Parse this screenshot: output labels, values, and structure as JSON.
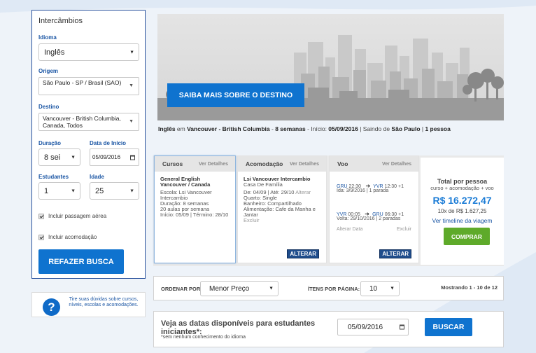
{
  "sidebar": {
    "title": "Intercâmbios",
    "idioma_label": "Idioma",
    "idioma_value": "Inglês",
    "origem_label": "Origem",
    "origem_value": "São Paulo - SP / Brasil (SAO)",
    "destino_label": "Destino",
    "destino_value": "Vancouver - British Columbia, Canada, Todos",
    "duracao_label": "Duração",
    "duracao_value": "8 sei",
    "data_label": "Data de Início",
    "data_value": "05/09/2016",
    "estudantes_label": "Estudantes",
    "estudantes_value": "1",
    "idade_label": "Idade",
    "idade_value": "25",
    "chk_passagem": "Incluir passagem aérea",
    "chk_acomodacao": "Incluir acomodação",
    "refazer_label": "REFAZER BUSCA"
  },
  "help": {
    "icon_char": "?",
    "text": "Tire suas dúvidas sobre cursos, níveis, escolas e acomodações."
  },
  "banner": {
    "button_label": "SAIBA MAIS SOBRE O DESTINO"
  },
  "summary": {
    "lang": "Inglês",
    "em": " em ",
    "dest": "Vancouver - British Columbia",
    "sep1": " - ",
    "weeks": "8 semanas",
    "sep2": " - Início: ",
    "start": "05/09/2016",
    "sep3": " | Saindo de ",
    "origin": "São Paulo",
    "sep4": " | ",
    "people": "1 pessoa"
  },
  "cursos": {
    "title": "Cursos",
    "details": "Ver Detalhes",
    "name": "General English",
    "city": "Vancouver / Canada",
    "school": "Escola: Lsi Vancouver Intercambio",
    "duration": "Duração: 8 semanas",
    "lessons": "20 aulas por semana",
    "dates": "Início: 05/09 | Término: 28/10"
  },
  "acomodacao": {
    "title": "Acomodação",
    "details": "Ver Detalhes",
    "name": "Lsi Vancouver Intercambio",
    "type": "Casa De Família",
    "dates": "De: 04/09 | Até: 29/10",
    "alterar_inline": "Alterar",
    "room": "Quarto: Single",
    "bath": "Banheiro: Compartilhado",
    "food": "Alimentação: Cafe da Manha e Jantar",
    "excluir": "Excluir",
    "alterar_btn": "ALTERAR"
  },
  "voo": {
    "title": "Voo",
    "details": "Ver Detalhes",
    "out_from": "GRU",
    "out_from_time": "22:30",
    "out_to": "YVR",
    "out_to_time": "12:30 +1",
    "out_info": "Ida: 3/9/2016 | 1 parada",
    "ret_from": "YVR",
    "ret_from_time": "00:05",
    "ret_to": "GRU",
    "ret_to_time": "06:30 +1",
    "ret_info": "Volta: 29/10/2016 | 2 paradas",
    "alterar_data": "Alterar Data",
    "excluir": "Excluir",
    "alterar_btn": "ALTERAR"
  },
  "total": {
    "title": "Total por pessoa",
    "subtitle": "curso + acomodação + voo",
    "price": "R$ 16.272,47",
    "installments": "10x de R$ 1.627,25",
    "timeline": "Ver timeline da viagem",
    "buy_label": "COMPRAR"
  },
  "sortbar": {
    "order_label": "ORDENAR POR:",
    "order_value": "Menor Preço",
    "items_label": "ÍTENS POR PÁGINA:",
    "items_value": "10",
    "showing": "Mostrando 1 - 10 de 12"
  },
  "promo": {
    "title": "Veja as datas disponíveis para estudantes iniciantes*:",
    "subtitle": "*sem nenhum conhecimento do idioma",
    "date_value": "05/09/2016",
    "button_label": "BUSCAR"
  },
  "colors": {
    "primary_blue": "#0f73cf",
    "green": "#5eaa2a",
    "navy": "#1f4d8c"
  }
}
